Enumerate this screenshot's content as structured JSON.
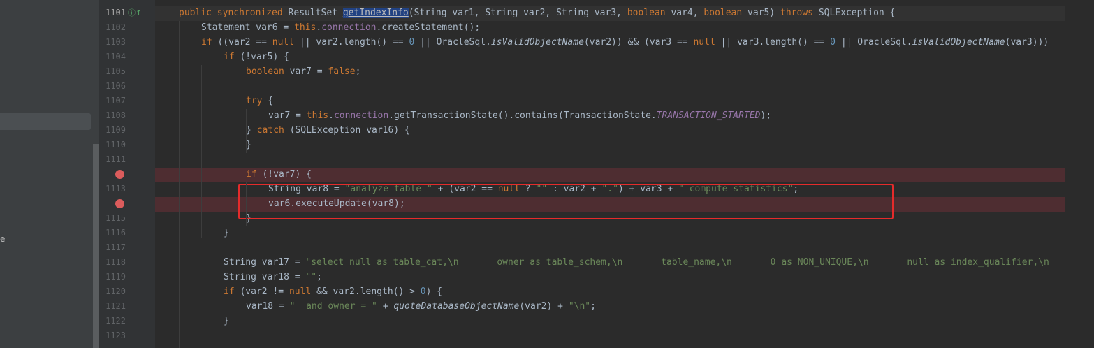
{
  "sidebar": {
    "fragment": "e"
  },
  "lines": [
    {
      "n": "1101",
      "c": [
        [
          "kw",
          "public synchronized "
        ],
        [
          "",
          "ResultSet "
        ],
        [
          "hlw",
          "getIndexInfo"
        ],
        [
          "",
          "(String var1, String var2, String var3, "
        ],
        [
          "kw",
          "boolean "
        ],
        [
          "",
          "var4, "
        ],
        [
          "kw",
          "boolean "
        ],
        [
          "",
          "var5) "
        ],
        [
          "kw",
          "throws "
        ],
        [
          "",
          "SQLException {"
        ]
      ]
    },
    {
      "n": "1102",
      "c": [
        [
          "",
          "Statement var6 = "
        ],
        [
          "kw",
          "this"
        ],
        [
          "",
          "."
        ],
        [
          "fd",
          "connection"
        ],
        [
          "",
          ".createStatement();"
        ]
      ]
    },
    {
      "n": "1103",
      "c": [
        [
          "kw",
          "if "
        ],
        [
          "",
          "((var2 == "
        ],
        [
          "kw",
          "null "
        ],
        [
          "",
          "|| var2.length() == "
        ],
        [
          "nm",
          "0 "
        ],
        [
          "",
          "|| OracleSql."
        ],
        [
          "ist",
          "isValidObjectName"
        ],
        [
          "",
          "(var2)) && (var3 == "
        ],
        [
          "kw",
          "null "
        ],
        [
          "",
          "|| var3.length() == "
        ],
        [
          "nm",
          "0 "
        ],
        [
          "",
          "|| OracleSql."
        ],
        [
          "ist",
          "isValidObjectName"
        ],
        [
          "",
          "(var3)))"
        ]
      ]
    },
    {
      "n": "1104",
      "c": [
        [
          "kw",
          "if "
        ],
        [
          "",
          "(!var5) {"
        ]
      ]
    },
    {
      "n": "1105",
      "c": [
        [
          "kw",
          "boolean "
        ],
        [
          "",
          "var7 = "
        ],
        [
          "kw",
          "false"
        ],
        [
          "",
          ";"
        ]
      ]
    },
    {
      "n": "1106",
      "c": []
    },
    {
      "n": "1107",
      "c": [
        [
          "kw",
          "try "
        ],
        [
          "",
          "{"
        ]
      ]
    },
    {
      "n": "1108",
      "c": [
        [
          "",
          "var7 = "
        ],
        [
          "kw",
          "this"
        ],
        [
          "",
          "."
        ],
        [
          "fd",
          "connection"
        ],
        [
          "",
          ".getTransactionState().contains(TransactionState."
        ],
        [
          "it",
          "TRANSACTION_STARTED"
        ],
        [
          "",
          ");"
        ]
      ]
    },
    {
      "n": "1109",
      "c": [
        [
          "",
          "} "
        ],
        [
          "kw",
          "catch "
        ],
        [
          "",
          "(SQLException var16) {"
        ]
      ]
    },
    {
      "n": "1110",
      "c": [
        [
          "",
          "}"
        ]
      ]
    },
    {
      "n": "1111",
      "c": []
    },
    {
      "n": "",
      "c": [
        [
          "kw",
          "if "
        ],
        [
          "",
          "(!var7) {"
        ]
      ]
    },
    {
      "n": "1113",
      "c": [
        [
          "",
          "String var8 = "
        ],
        [
          "st",
          "\"analyze table \" "
        ],
        [
          "",
          "+ (var2 == "
        ],
        [
          "kw",
          "null "
        ],
        [
          "",
          "? "
        ],
        [
          "st",
          "\"\" "
        ],
        [
          "",
          ": var2 + "
        ],
        [
          "st",
          "\".\""
        ],
        [
          "",
          ") + var3 + "
        ],
        [
          "st",
          "\" compute statistics\""
        ],
        [
          "",
          ";"
        ]
      ]
    },
    {
      "n": "",
      "c": [
        [
          "",
          "var6.executeUpdate(var8);"
        ]
      ]
    },
    {
      "n": "1115",
      "c": [
        [
          "",
          "}"
        ]
      ]
    },
    {
      "n": "1116",
      "c": [
        [
          "",
          "}"
        ]
      ]
    },
    {
      "n": "1117",
      "c": []
    },
    {
      "n": "1118",
      "c": [
        [
          "",
          "String var17 = "
        ],
        [
          "st",
          "\"select null as table_cat,\\n       owner as table_schem,\\n       table_name,\\n       0 as NON_UNIQUE,\\n       null as index_qualifier,\\n"
        ]
      ]
    },
    {
      "n": "1119",
      "c": [
        [
          "",
          "String var18 = "
        ],
        [
          "st",
          "\"\""
        ],
        [
          "",
          ";"
        ]
      ]
    },
    {
      "n": "1120",
      "c": [
        [
          "kw",
          "if "
        ],
        [
          "",
          "(var2 != "
        ],
        [
          "kw",
          "null "
        ],
        [
          "",
          "&& var2.length() > "
        ],
        [
          "nm",
          "0"
        ],
        [
          "",
          ") {"
        ]
      ]
    },
    {
      "n": "1121",
      "c": [
        [
          "",
          "var18 = "
        ],
        [
          "st",
          "\"  and owner = \" "
        ],
        [
          "",
          "+ "
        ],
        [
          "ist",
          "quoteDatabaseObjectName"
        ],
        [
          "",
          "(var2) + "
        ],
        [
          "st",
          "\"\\n\""
        ],
        [
          "",
          ";"
        ]
      ]
    },
    {
      "n": "1122",
      "c": [
        [
          "",
          "}"
        ]
      ]
    },
    {
      "n": "1123",
      "c": []
    }
  ]
}
